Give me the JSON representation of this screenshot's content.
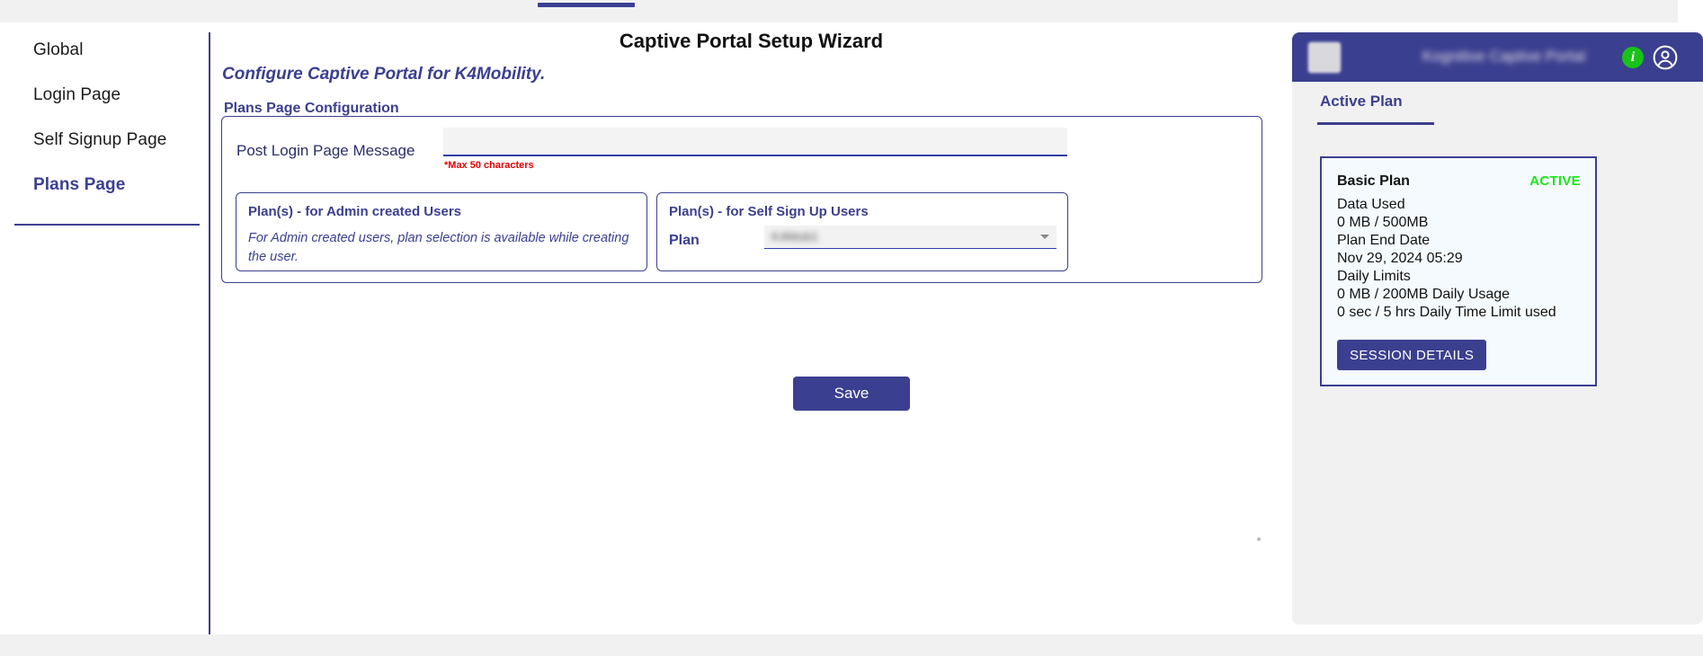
{
  "browser": {
    "tab_indicator": "active-tab-bar"
  },
  "sidebar": {
    "items": [
      {
        "label": "Global",
        "active": false
      },
      {
        "label": "Login Page",
        "active": false
      },
      {
        "label": "Self Signup Page",
        "active": false
      },
      {
        "label": "Plans Page",
        "active": true
      }
    ]
  },
  "main": {
    "title": "Captive Portal Setup Wizard",
    "subtitle": "Configure Captive Portal for K4Mobility.",
    "section_label": "Plans Page Configuration",
    "back_icon": "arrow-left-icon",
    "form": {
      "post_login_label": "Post Login Page Message",
      "post_login_value": "",
      "post_login_placeholder": "",
      "post_login_hint": "*Max 50 characters"
    },
    "admin_panel": {
      "title": "Plan(s) - for Admin created Users",
      "description": "For Admin created users, plan selection is available while creating the user."
    },
    "self_panel": {
      "title": "Plan(s) - for Self Sign Up Users",
      "plan_label": "Plan",
      "plan_value": "K4Mob1",
      "dropdown_icon": "chevron-down-icon"
    },
    "save_label": "Save"
  },
  "preview": {
    "brand": "Kognitive Captive Portal",
    "logo": "brand-logo",
    "info_icon": "i",
    "account_icon": "account-circle-icon",
    "tab_label": "Active Plan",
    "plan_card": {
      "name": "Basic Plan",
      "status": "ACTIVE",
      "lines": [
        "Data Used",
        "0 MB / 500MB",
        "Plan End Date",
        "Nov 29, 2024 05:29",
        "Daily Limits",
        "0 MB / 200MB Daily Usage",
        "0 sec / 5 hrs Daily Time Limit used"
      ],
      "session_button_label": "SESSION DETAILS"
    }
  },
  "colors": {
    "brand_navy": "#3b3f8f",
    "accent_mint": "#7ef0b4",
    "status_green": "#1ae61a",
    "hint_red": "#e00000",
    "panel_bg": "#f5fafe"
  }
}
